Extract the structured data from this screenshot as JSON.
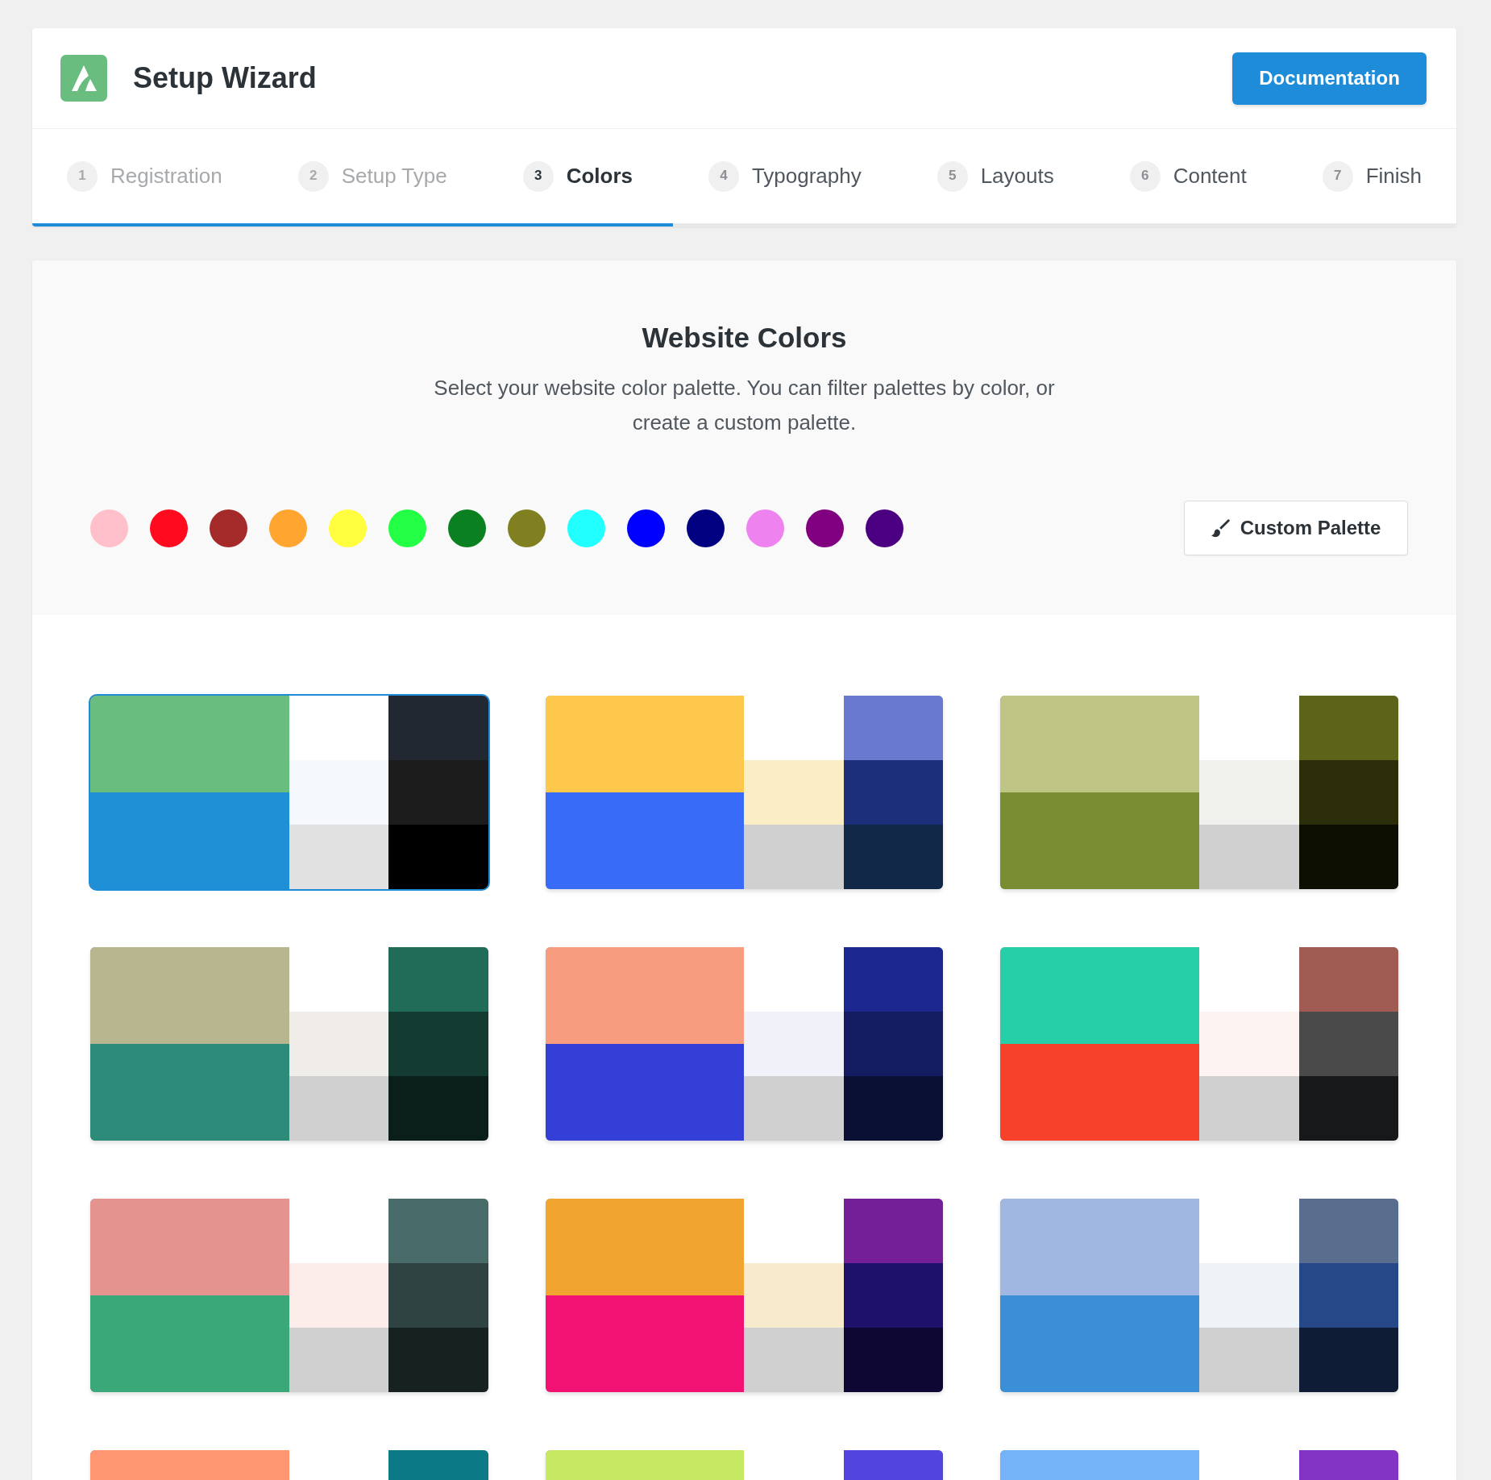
{
  "header": {
    "title": "Setup Wizard",
    "button": "Documentation"
  },
  "steps": [
    {
      "number": "1",
      "label": "Registration",
      "completed": true,
      "selected": false
    },
    {
      "number": "2",
      "label": "Setup Type",
      "completed": true,
      "selected": false
    },
    {
      "number": "3",
      "label": "Colors",
      "completed": false,
      "selected": true
    },
    {
      "number": "4",
      "label": "Typography",
      "completed": false,
      "selected": false
    },
    {
      "number": "5",
      "label": "Layouts",
      "completed": false,
      "selected": false
    },
    {
      "number": "6",
      "label": "Content",
      "completed": false,
      "selected": false
    },
    {
      "number": "7",
      "label": "Finish",
      "completed": false,
      "selected": false
    }
  ],
  "progress": {
    "level": 0.45
  },
  "colors_panel": {
    "title": "Website Colors",
    "description": "Select your website color palette. You can filter palettes by color, or create a custom palette.",
    "filters": [
      {
        "color": "#ffc0cb"
      },
      {
        "color": "#ff0a1e"
      },
      {
        "color": "#a52a2a"
      },
      {
        "color": "#ffa530"
      },
      {
        "color": "#ffff40"
      },
      {
        "color": "#22ff44"
      },
      {
        "color": "#0b8020"
      },
      {
        "color": "#808020"
      },
      {
        "color": "#22ffff"
      },
      {
        "color": "#0000ff"
      },
      {
        "color": "#000080"
      },
      {
        "color": "#ee82ee"
      },
      {
        "color": "#800080"
      },
      {
        "color": "#4b0082"
      }
    ],
    "custom_button": "Custom Palette"
  },
  "palettes": [
    {
      "selected": true,
      "main": [
        {
          "color": "#68bd7f"
        },
        {
          "color": "#1f8fd6"
        }
      ],
      "light": [
        {
          "color": "#ffffff"
        },
        {
          "color": "#f5f9fd"
        },
        {
          "color": "#e1e1e1"
        }
      ],
      "dark": [
        {
          "color": "#212831"
        },
        {
          "color": "#1c1c1c"
        },
        {
          "color": "#000000"
        }
      ]
    },
    {
      "selected": false,
      "main": [
        {
          "color": "#fec84d"
        },
        {
          "color": "#376bf8"
        }
      ],
      "light": [
        {
          "color": "#ffffff"
        },
        {
          "color": "#fbeec4"
        },
        {
          "color": "#d0d0d0"
        }
      ],
      "dark": [
        {
          "color": "#6879cf"
        },
        {
          "color": "#1c2f7a"
        },
        {
          "color": "#112849"
        }
      ]
    },
    {
      "selected": false,
      "main": [
        {
          "color": "#bfc584"
        },
        {
          "color": "#798d33"
        }
      ],
      "light": [
        {
          "color": "#ffffff"
        },
        {
          "color": "#f0f1ec"
        },
        {
          "color": "#d0d0d0"
        }
      ],
      "dark": [
        {
          "color": "#5b6418"
        },
        {
          "color": "#2c2d09"
        },
        {
          "color": "#0e0f03"
        }
      ]
    },
    {
      "selected": false,
      "main": [
        {
          "color": "#b8b68f"
        },
        {
          "color": "#2d8b79"
        }
      ],
      "light": [
        {
          "color": "#ffffff"
        },
        {
          "color": "#f0ede8"
        },
        {
          "color": "#d0d0d0"
        }
      ],
      "dark": [
        {
          "color": "#216c58"
        },
        {
          "color": "#133b31"
        },
        {
          "color": "#0a1e1a"
        }
      ]
    },
    {
      "selected": false,
      "main": [
        {
          "color": "#f79c7e"
        },
        {
          "color": "#333fd6"
        }
      ],
      "light": [
        {
          "color": "#ffffff"
        },
        {
          "color": "#f1f2f9"
        },
        {
          "color": "#d0d0d0"
        }
      ],
      "dark": [
        {
          "color": "#1d2790"
        },
        {
          "color": "#141c61"
        },
        {
          "color": "#0a0f34"
        }
      ]
    },
    {
      "selected": false,
      "main": [
        {
          "color": "#26cfa7"
        },
        {
          "color": "#f8412b"
        }
      ],
      "light": [
        {
          "color": "#ffffff"
        },
        {
          "color": "#fdf3f1"
        },
        {
          "color": "#d0d0d0"
        }
      ],
      "dark": [
        {
          "color": "#a05c52"
        },
        {
          "color": "#4a4a4a"
        },
        {
          "color": "#161819"
        }
      ]
    },
    {
      "selected": false,
      "main": [
        {
          "color": "#e4938f"
        },
        {
          "color": "#3aa878"
        }
      ],
      "light": [
        {
          "color": "#ffffff"
        },
        {
          "color": "#fcecea"
        },
        {
          "color": "#d0d0d0"
        }
      ],
      "dark": [
        {
          "color": "#496c6a"
        },
        {
          "color": "#2e4342"
        },
        {
          "color": "#172220"
        }
      ]
    },
    {
      "selected": false,
      "main": [
        {
          "color": "#f2a431"
        },
        {
          "color": "#f21273"
        }
      ],
      "light": [
        {
          "color": "#ffffff"
        },
        {
          "color": "#f8eacc"
        },
        {
          "color": "#d0d0d0"
        }
      ],
      "dark": [
        {
          "color": "#741f97"
        },
        {
          "color": "#1d116b"
        },
        {
          "color": "#0f0733"
        }
      ]
    },
    {
      "selected": false,
      "main": [
        {
          "color": "#a0b7e2"
        },
        {
          "color": "#3b8fd6"
        }
      ],
      "light": [
        {
          "color": "#ffffff"
        },
        {
          "color": "#eef3f8"
        },
        {
          "color": "#d0d0d0"
        }
      ],
      "dark": [
        {
          "color": "#596d8e"
        },
        {
          "color": "#264788"
        },
        {
          "color": "#0e1c35"
        }
      ]
    },
    {
      "selected": false,
      "main": [
        {
          "color": "#ff9672"
        }
      ],
      "light": [
        {
          "color": "#ffffff"
        }
      ],
      "dark": [
        {
          "color": "#0c7a86"
        }
      ]
    },
    {
      "selected": false,
      "main": [
        {
          "color": "#c7e863"
        }
      ],
      "light": [
        {
          "color": "#ffffff"
        }
      ],
      "dark": [
        {
          "color": "#5244df"
        }
      ]
    },
    {
      "selected": false,
      "main": [
        {
          "color": "#74b3f8"
        }
      ],
      "light": [
        {
          "color": "#ffffff"
        }
      ],
      "dark": [
        {
          "color": "#8334c5"
        }
      ]
    }
  ]
}
